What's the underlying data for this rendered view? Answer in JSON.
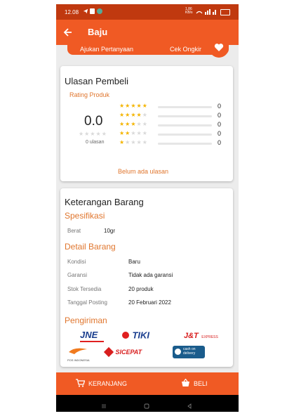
{
  "status": {
    "time": "12.08",
    "net_speed_top": "1,86",
    "net_speed_bottom": "KB/s"
  },
  "header": {
    "title": "Baju"
  },
  "subbar": {
    "ask": "Ajukan Pertanyaan",
    "ongkir": "Cek Ongkir"
  },
  "reviews": {
    "title": "Ulasan Pembeli",
    "rating_label": "Rating Produk",
    "score": "0.0",
    "count_text": "0 ulasan",
    "rows": [
      {
        "stars": 5,
        "count": "0"
      },
      {
        "stars": 4,
        "count": "0"
      },
      {
        "stars": 3,
        "count": "0"
      },
      {
        "stars": 2,
        "count": "0"
      },
      {
        "stars": 1,
        "count": "0"
      }
    ],
    "empty_text": "Belum ada ulasan"
  },
  "info": {
    "title": "Keterangan Barang",
    "spec_title": "Spesifikasi",
    "spec": {
      "label": "Berat",
      "value": "10gr"
    },
    "detail_title": "Detail Barang",
    "details": [
      {
        "label": "Kondisi",
        "value": "Baru"
      },
      {
        "label": "Garansi",
        "value": "Tidak ada garansi"
      },
      {
        "label": "Stok Tersedia",
        "value": "20 produk"
      },
      {
        "label": "Tanggal Posting",
        "value": "20 Februari 2022"
      }
    ],
    "shipping_title": "Pengiriman",
    "couriers": {
      "jne": "JNE",
      "tiki": "TIKI",
      "jnt": "J&T",
      "jnt_sub": "EXPRESS",
      "pos": "POS INDONESIA",
      "sicepat": "SICEPAT",
      "cod_top": "cash on",
      "cod_bottom": "delivery"
    }
  },
  "bottom": {
    "cart_label": "KERANJANG",
    "buy_label": "BELI"
  },
  "colors": {
    "primary": "#f05a24",
    "status": "#c0390f",
    "accent_text": "#e0762e",
    "star": "#f4b400"
  }
}
